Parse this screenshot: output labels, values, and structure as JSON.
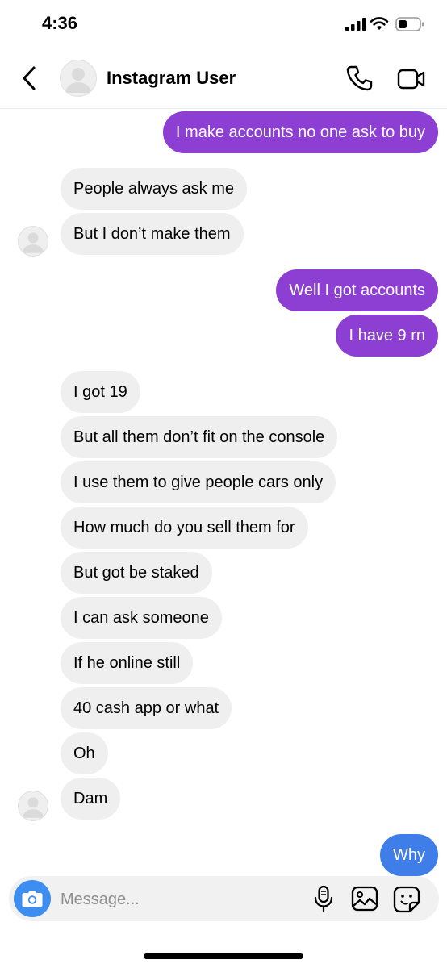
{
  "status_bar": {
    "time": "4:36"
  },
  "header": {
    "contact_name": "Instagram User"
  },
  "messages": [
    {
      "text": "I make accounts no one ask to buy",
      "from": "me",
      "color": "#8e3fd3"
    },
    {
      "text": "People always ask me",
      "from": "them"
    },
    {
      "text": "But I don’t make them",
      "from": "them"
    },
    {
      "text": "Well I got accounts",
      "from": "me",
      "color": "#8e3fd3"
    },
    {
      "text": "I have 9 rn",
      "from": "me",
      "color": "#8e3fd3"
    },
    {
      "text": "I got 19",
      "from": "them"
    },
    {
      "text": "But all them don’t fit on the console",
      "from": "them"
    },
    {
      "text": "I use them to give people cars only",
      "from": "them"
    },
    {
      "text": "How much do you sell them for",
      "from": "them"
    },
    {
      "text": "But got be staked",
      "from": "them"
    },
    {
      "text": "I can ask someone",
      "from": "them"
    },
    {
      "text": "If he online still",
      "from": "them"
    },
    {
      "text": "40 cash app or what",
      "from": "them"
    },
    {
      "text": "Oh",
      "from": "them"
    },
    {
      "text": "Dam",
      "from": "them"
    },
    {
      "text": "Why",
      "from": "me",
      "color": "#3f7de8"
    }
  ],
  "composer": {
    "placeholder": "Message...",
    "value": ""
  },
  "icons": {
    "back": "chevron-left-icon",
    "call": "phone-icon",
    "video": "video-camera-icon",
    "camera": "camera-icon",
    "mic": "microphone-icon",
    "gallery": "image-icon",
    "sticker": "sticker-icon"
  },
  "colors": {
    "outgoing_purple": "#8e3fd3",
    "outgoing_blue": "#3f7de8",
    "incoming": "#efefef",
    "camera_button": "#3d8ef0"
  }
}
